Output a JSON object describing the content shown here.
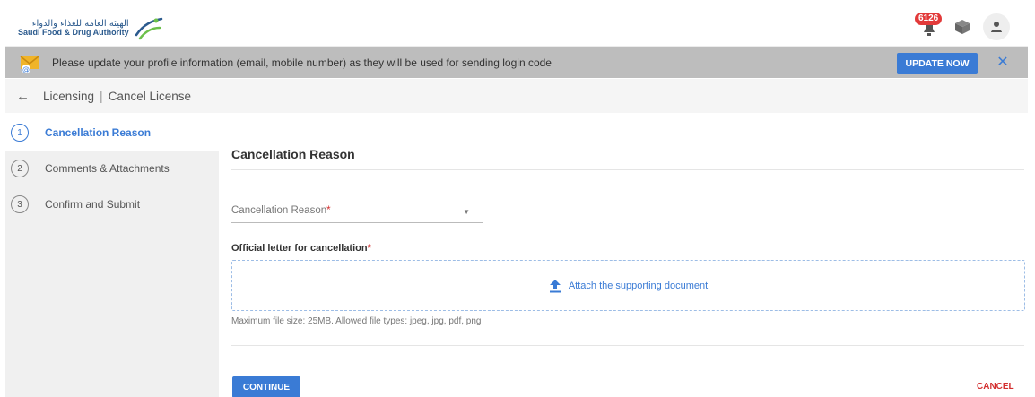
{
  "header": {
    "logo_ar": "الهيئة العامة للغذاء والدواء",
    "logo_en": "Saudi Food & Drug Authority",
    "notification_count": "6126",
    "icons": {
      "notifications": "bell-icon",
      "box": "box-icon",
      "user": "user-icon"
    }
  },
  "banner": {
    "message": "Please update your profile information (email, mobile number) as they will be used for sending login code",
    "action_label": "UPDATE NOW",
    "close_symbol": "✕",
    "icon": "envelope-at-icon"
  },
  "breadcrumb": {
    "back_symbol": "←",
    "section": "Licensing",
    "separator": "|",
    "page": "Cancel License"
  },
  "steps": [
    {
      "number": "1",
      "label": "Cancellation Reason",
      "active": true
    },
    {
      "number": "2",
      "label": "Comments & Attachments",
      "active": false
    },
    {
      "number": "3",
      "label": "Confirm and Submit",
      "active": false
    }
  ],
  "form": {
    "title": "Cancellation Reason",
    "reason_field": {
      "label": "Cancellation Reason",
      "required_mark": "*",
      "value": ""
    },
    "upload": {
      "label": "Official letter for cancellation",
      "required_mark": "*",
      "prompt": "Attach the supporting document",
      "hint": "Maximum file size: 25MB. Allowed file types: jpeg, jpg, pdf, png"
    },
    "continue_label": "CONTINUE",
    "cancel_label": "CANCEL"
  },
  "colors": {
    "accent": "#3a7bd5",
    "banner_bg": "#bdbdbd",
    "danger": "#d32f2f",
    "sidebar_bg": "#f0f0f0"
  }
}
